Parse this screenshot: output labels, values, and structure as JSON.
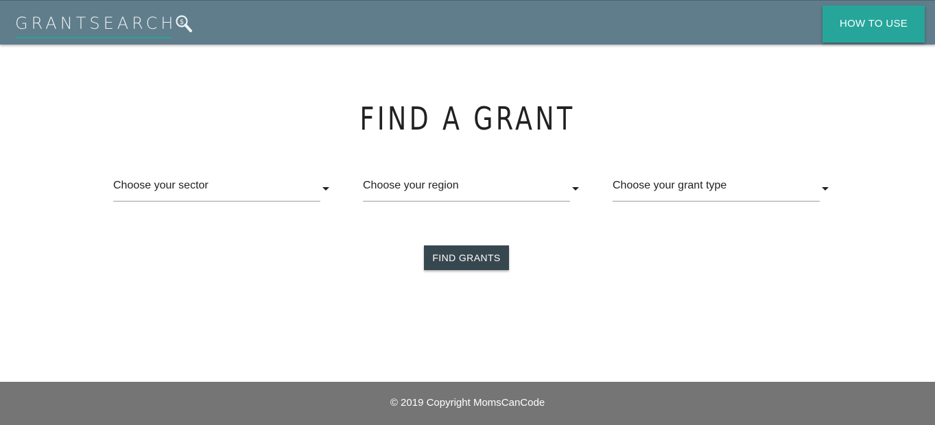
{
  "header": {
    "logo_text": "GRANTSEARCH",
    "logo_icon": "magnifier-dollar-icon",
    "how_to_use_label": "HOW TO USE"
  },
  "main": {
    "title": "FIND A GRANT",
    "selects": {
      "sector": "Choose your sector",
      "region": "Choose your region",
      "grant_type": "Choose your grant type"
    },
    "find_button_label": "FIND GRANTS"
  },
  "footer": {
    "copyright": "© 2019 Copyright MomsCanCode"
  },
  "colors": {
    "header_bg": "#607d8b",
    "accent_teal": "#26a69a",
    "button_dark": "#37474f",
    "footer_bg": "#757575"
  }
}
